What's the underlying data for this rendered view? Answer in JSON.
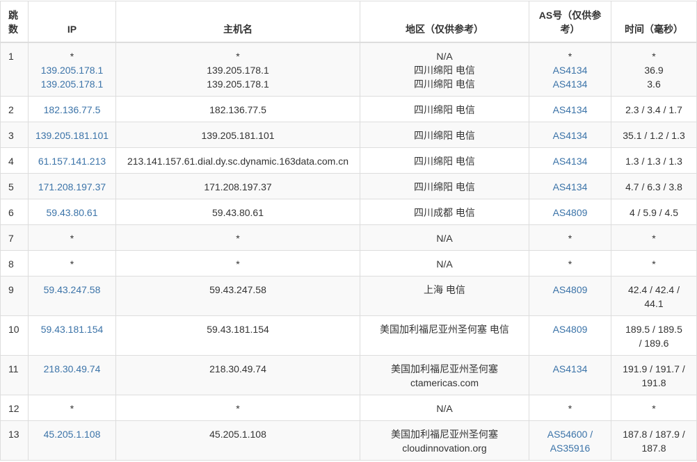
{
  "table": {
    "headers": {
      "hop": "跳数",
      "ip": "IP",
      "host": "主机名",
      "area": "地区（仅供参考）",
      "as": "AS号（仅供参考）",
      "time": "时间（毫秒）"
    },
    "rows": [
      {
        "hop": "1",
        "ip": [
          "*",
          "139.205.178.1",
          "139.205.178.1"
        ],
        "host": [
          "*",
          "139.205.178.1",
          "139.205.178.1"
        ],
        "area": [
          "N/A",
          "四川绵阳 电信",
          "四川绵阳 电信"
        ],
        "as": [
          "*",
          "AS4134",
          "AS4134"
        ],
        "time": [
          "*",
          "36.9",
          "3.6"
        ]
      },
      {
        "hop": "2",
        "ip": [
          "182.136.77.5"
        ],
        "host": [
          "182.136.77.5"
        ],
        "area": [
          "四川绵阳 电信"
        ],
        "as": [
          "AS4134"
        ],
        "time": [
          "2.3 / 3.4 / 1.7"
        ]
      },
      {
        "hop": "3",
        "ip": [
          "139.205.181.101"
        ],
        "host": [
          "139.205.181.101"
        ],
        "area": [
          "四川绵阳 电信"
        ],
        "as": [
          "AS4134"
        ],
        "time": [
          "35.1 / 1.2 / 1.3"
        ]
      },
      {
        "hop": "4",
        "ip": [
          "61.157.141.213"
        ],
        "host": [
          "213.141.157.61.dial.dy.sc.dynamic.163data.com.cn"
        ],
        "area": [
          "四川绵阳 电信"
        ],
        "as": [
          "AS4134"
        ],
        "time": [
          "1.3 / 1.3 / 1.3"
        ]
      },
      {
        "hop": "5",
        "ip": [
          "171.208.197.37"
        ],
        "host": [
          "171.208.197.37"
        ],
        "area": [
          "四川绵阳 电信"
        ],
        "as": [
          "AS4134"
        ],
        "time": [
          "4.7 / 6.3 / 3.8"
        ]
      },
      {
        "hop": "6",
        "ip": [
          "59.43.80.61"
        ],
        "host": [
          "59.43.80.61"
        ],
        "area": [
          "四川成都 电信"
        ],
        "as": [
          "AS4809"
        ],
        "time": [
          "4 / 5.9 / 4.5"
        ]
      },
      {
        "hop": "7",
        "ip": [
          "*"
        ],
        "host": [
          "*"
        ],
        "area": [
          "N/A"
        ],
        "as": [
          "*"
        ],
        "time": [
          "*"
        ]
      },
      {
        "hop": "8",
        "ip": [
          "*"
        ],
        "host": [
          "*"
        ],
        "area": [
          "N/A"
        ],
        "as": [
          "*"
        ],
        "time": [
          "*"
        ]
      },
      {
        "hop": "9",
        "ip": [
          "59.43.247.58"
        ],
        "host": [
          "59.43.247.58"
        ],
        "area": [
          "上海 电信"
        ],
        "as": [
          "AS4809"
        ],
        "time": [
          "42.4 / 42.4 /",
          "44.1"
        ]
      },
      {
        "hop": "10",
        "ip": [
          "59.43.181.154"
        ],
        "host": [
          "59.43.181.154"
        ],
        "area": [
          "美国加利福尼亚州圣何塞 电信"
        ],
        "as": [
          "AS4809"
        ],
        "time": [
          "189.5 / 189.5",
          "/ 189.6"
        ]
      },
      {
        "hop": "11",
        "ip": [
          "218.30.49.74"
        ],
        "host": [
          "218.30.49.74"
        ],
        "area": [
          "美国加利福尼亚州圣何塞",
          "ctamericas.com"
        ],
        "as": [
          "AS4134"
        ],
        "time": [
          "191.9 / 191.7 /",
          "191.8"
        ]
      },
      {
        "hop": "12",
        "ip": [
          "*"
        ],
        "host": [
          "*"
        ],
        "area": [
          "N/A"
        ],
        "as": [
          "*"
        ],
        "time": [
          "*"
        ]
      },
      {
        "hop": "13",
        "ip": [
          "45.205.1.108"
        ],
        "host": [
          "45.205.1.108"
        ],
        "area": [
          "美国加利福尼亚州圣何塞",
          "cloudinnovation.org"
        ],
        "as": [
          "AS54600 /",
          "AS35916"
        ],
        "time": [
          "187.8 / 187.9 /",
          "187.8"
        ]
      }
    ]
  }
}
